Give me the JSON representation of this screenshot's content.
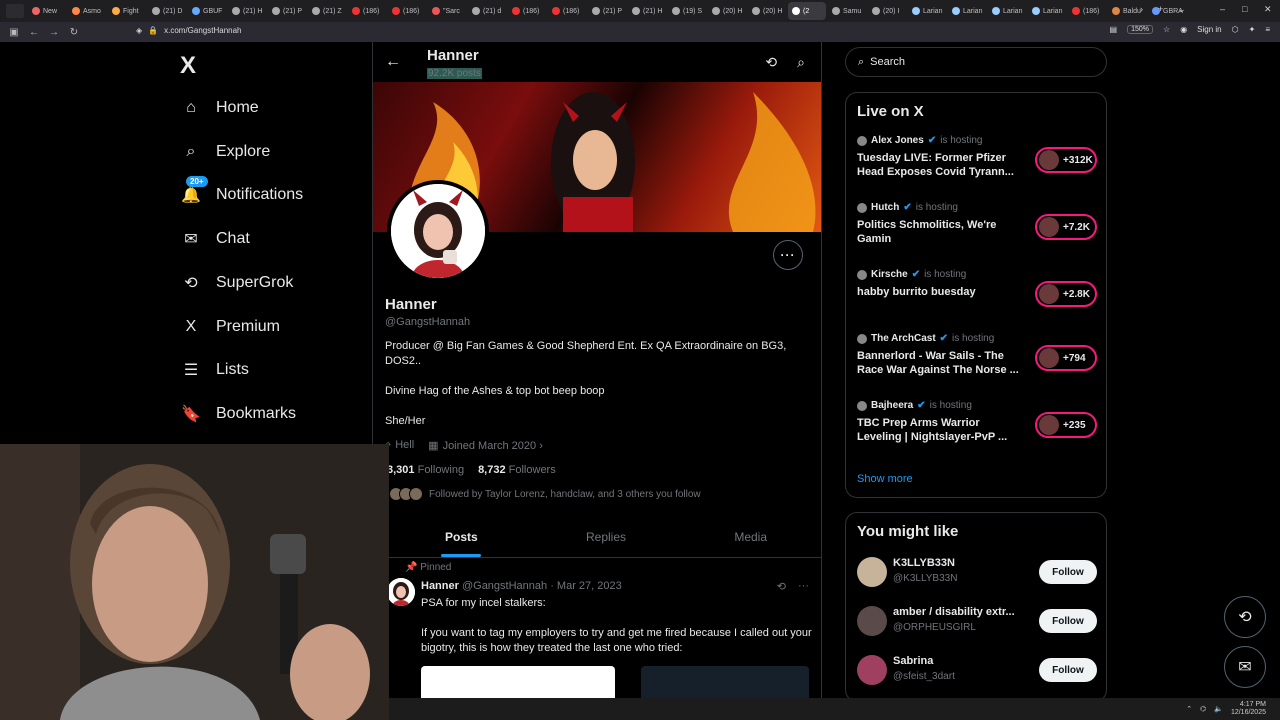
{
  "browser": {
    "tabs": [
      "New",
      "Asmo",
      "Fight",
      "(21) D",
      "GBUF",
      "(21) H",
      "(21) P",
      "(21) Z",
      "(186)",
      "(186)",
      "\"Sarc",
      "(21) d",
      "(186)",
      "(186)",
      "(21) P",
      "(21) H",
      "(19) S",
      "(20) H",
      "(20) H",
      "(2",
      "Samu",
      "(20) I",
      "Larian",
      "Larian",
      "Larian",
      "Larian",
      "(186)",
      "Baldu",
      "GBRA"
    ],
    "active_tab_index": 19,
    "url": "x.com/GangstHannah",
    "zoom": "150%",
    "signin": "Sign in"
  },
  "nav": {
    "logo": "X",
    "notif_badge": "20+",
    "items": [
      {
        "label": "Home",
        "icon": "home-icon"
      },
      {
        "label": "Explore",
        "icon": "search-icon"
      },
      {
        "label": "Notifications",
        "icon": "bell-icon"
      },
      {
        "label": "Chat",
        "icon": "mail-icon"
      },
      {
        "label": "SuperGrok",
        "icon": "grok-icon"
      },
      {
        "label": "Premium",
        "icon": "x-icon"
      },
      {
        "label": "Lists",
        "icon": "list-icon"
      },
      {
        "label": "Bookmarks",
        "icon": "bookmark-icon"
      }
    ]
  },
  "profile": {
    "header_name": "Hanner",
    "post_count": "92.2K posts",
    "name": "Hanner",
    "handle": "@GangstHannah",
    "bio_line1": "Producer @ Big Fan Games & Good Shepherd Ent. Ex QA Extraordinaire on BG3, DOS2..",
    "bio_line2": "Divine Hag of the Ashes & top bot beep boop",
    "bio_line3": "She/Her",
    "location": "Hell",
    "joined": "Joined March 2020",
    "following_count": "3,301",
    "following_label": "Following",
    "followers_count": "8,732",
    "followers_label": "Followers",
    "followed_by": "Followed by Taylor Lorenz, handclaw, and 3 others you follow",
    "tabs": [
      "Posts",
      "Replies",
      "Media"
    ]
  },
  "tweet": {
    "pinned": "Pinned",
    "name": "Hanner",
    "handle_date": "@GangstHannah · Mar 27, 2023",
    "line1": "PSA for my incel stalkers:",
    "line2": "If you want to tag my employers to try and get me fired because I called out your bigotry, this is how they treated the last one who tried:"
  },
  "sidebar": {
    "search_placeholder": "Search",
    "live_title": "Live on X",
    "hosting": "is hosting",
    "live": [
      {
        "name": "Alex Jones",
        "title": "Tuesday LIVE: Former Pfizer Head Exposes Covid Tyrann...",
        "count": "+312K"
      },
      {
        "name": "Hutch",
        "title": "Politics Schmolitics, We're Gamin",
        "count": "+7.2K"
      },
      {
        "name": "Kirsche",
        "title": "habby burrito buesday",
        "count": "+2.8K"
      },
      {
        "name": "The ArchCast",
        "title": "Bannerlord - War Sails - The Race War Against The Norse ...",
        "count": "+794"
      },
      {
        "name": "Bajheera",
        "title": "TBC Prep Arms Warrior Leveling | Nightslayer-PvP ...",
        "count": "+235"
      }
    ],
    "show_more": "Show more",
    "suggest_title": "You might like",
    "suggestions": [
      {
        "name": "K3LLYB33N",
        "handle": "@K3LLYB33N",
        "button": "Follow"
      },
      {
        "name": "amber / disability extr...",
        "handle": "@ORPHEUSGIRL",
        "button": "Follow"
      },
      {
        "name": "Sabrina",
        "handle": "@sfeist_3dart",
        "button": "Follow"
      }
    ]
  },
  "taskbar": {
    "time": "4:17 PM",
    "date": "12/16/2025"
  }
}
